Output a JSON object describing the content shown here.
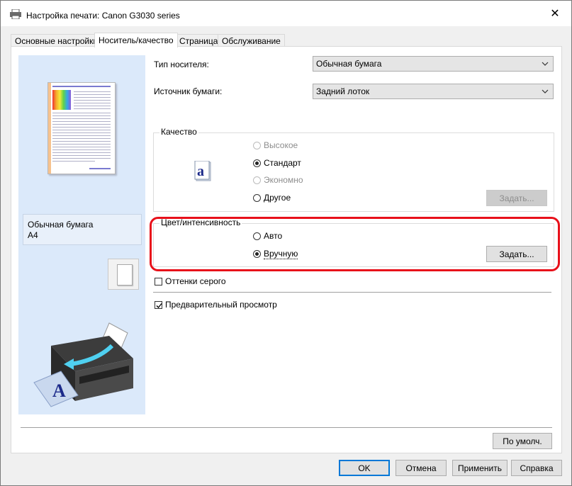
{
  "window": {
    "title": "Настройка печати: Canon G3030 series",
    "close_glyph": "✕"
  },
  "tabs": [
    {
      "label": "Основные настройки",
      "active": false
    },
    {
      "label": "Носитель/качество",
      "active": true
    },
    {
      "label": "Страница",
      "active": false
    },
    {
      "label": "Обслуживание",
      "active": false
    }
  ],
  "preview": {
    "media_name": "Обычная бумага",
    "paper_size": "A4"
  },
  "fields": {
    "media_type_label": "Тип носителя:",
    "media_type_value": "Обычная бумага",
    "paper_source_label": "Источник бумаги:",
    "paper_source_value": "Задний лоток"
  },
  "quality": {
    "title": "Качество",
    "options": [
      {
        "label": "Высокое",
        "checked": false,
        "disabled": true
      },
      {
        "label": "Стандарт",
        "checked": true,
        "disabled": false
      },
      {
        "label": "Экономно",
        "checked": false,
        "disabled": true
      },
      {
        "label": "Другое",
        "checked": false,
        "disabled": false
      }
    ],
    "set_button": "Задать..."
  },
  "color": {
    "title": "Цвет/интенсивность",
    "options": [
      {
        "label": "Авто",
        "checked": false
      },
      {
        "label": "Вручную",
        "checked": true
      }
    ],
    "set_button": "Задать..."
  },
  "checkboxes": {
    "grayscale": {
      "label": "Оттенки серого",
      "checked": false
    },
    "preview": {
      "label": "Предварительный просмотр",
      "checked": true
    }
  },
  "buttons": {
    "defaults": "По умолч.",
    "ok": "OK",
    "cancel": "Отмена",
    "apply": "Применить",
    "help": "Справка"
  },
  "colors": {
    "highlight": "#e8101a",
    "preview_background": "#dbe9fa",
    "default_button_border": "#0078d7"
  }
}
